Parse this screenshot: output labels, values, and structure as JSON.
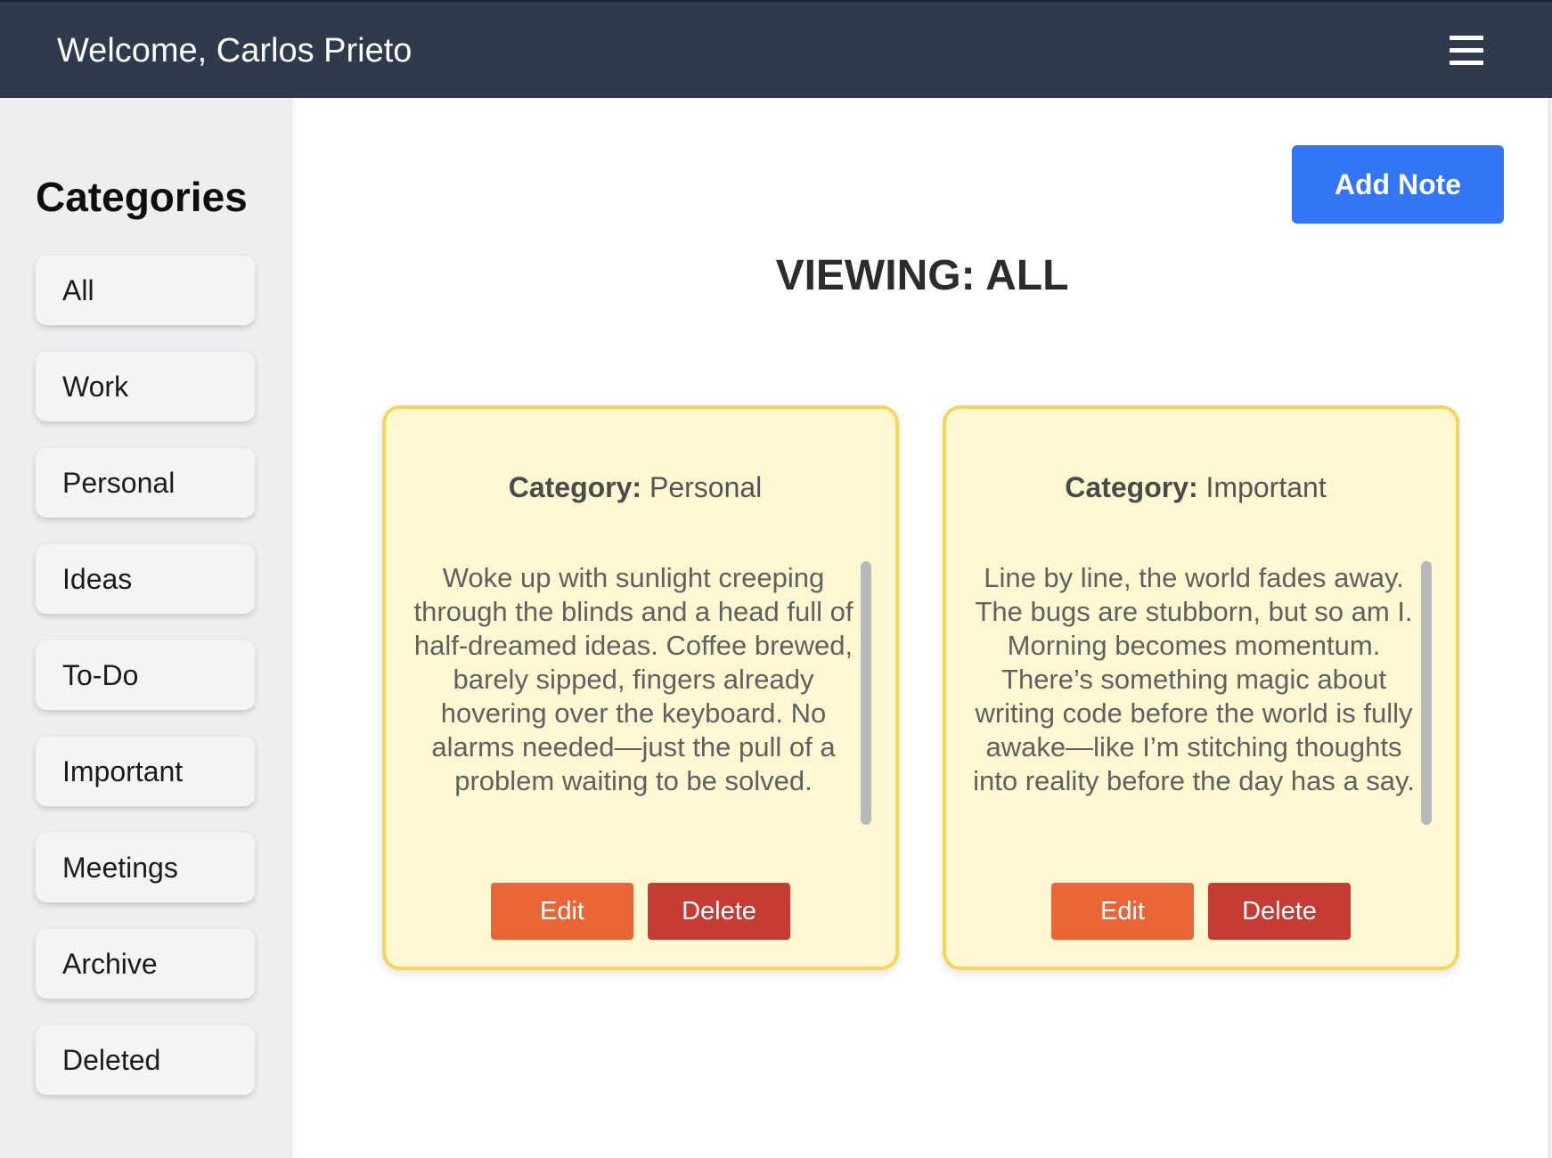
{
  "header": {
    "welcome_text": "Welcome, Carlos Prieto",
    "menu_icon": "hamburger-menu-icon"
  },
  "sidebar": {
    "title": "Categories",
    "items": [
      {
        "label": "All"
      },
      {
        "label": "Work"
      },
      {
        "label": "Personal"
      },
      {
        "label": "Ideas"
      },
      {
        "label": "To-Do"
      },
      {
        "label": "Important"
      },
      {
        "label": "Meetings"
      },
      {
        "label": "Archive"
      },
      {
        "label": "Deleted"
      }
    ]
  },
  "main": {
    "add_note_label": "Add Note",
    "viewing_title": "VIEWING: ALL",
    "notes": [
      {
        "category_label": "Category:",
        "category_value": "Personal",
        "body": "Woke up with sunlight creeping through the blinds and a head full of half-dreamed ideas. Coffee brewed, barely sipped, fingers already hovering over the keyboard. No alarms needed—just the pull of a problem waiting to be solved.",
        "edit_label": "Edit",
        "delete_label": "Delete"
      },
      {
        "category_label": "Category:",
        "category_value": "Important",
        "body": "Line by line, the world fades away. The bugs are stubborn, but so am I. Morning becomes momentum. There’s something magic about writing code before the world is fully awake—like I’m stitching thoughts into reality before the day has a say.",
        "edit_label": "Edit",
        "delete_label": "Delete"
      }
    ]
  },
  "colors": {
    "header_bg": "#2f3a4c",
    "sidebar_bg": "#eceeef",
    "primary_button": "#3275f5",
    "note_bg": "#fdf8d2",
    "note_border": "#f4d75a",
    "edit_button": "#ea6535",
    "delete_button": "#c63c35"
  }
}
